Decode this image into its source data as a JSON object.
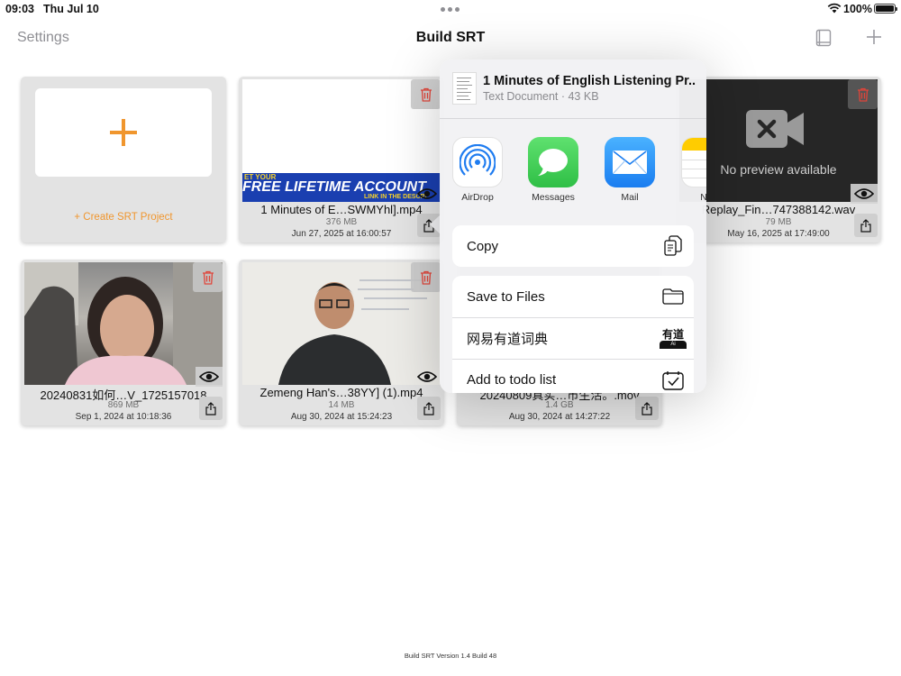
{
  "status_bar": {
    "time": "09:03",
    "date": "Thu Jul 10",
    "battery": "100%"
  },
  "nav": {
    "settings_label": "Settings",
    "title": "Build SRT"
  },
  "create_card": {
    "label": "+ Create SRT Project"
  },
  "projects": [
    {
      "name": "1 Minutes of E…SWMYhl].mp4",
      "size": "376 MB",
      "date": "Jun 27, 2025 at 16:00:57",
      "banner_line1": "ET YOUR",
      "banner_line2": "FREE LIFETIME ACCOUNT",
      "banner_line3": "LINK IN THE DESCRI"
    },
    {
      "name": "Replay_Fin…747388142.wav",
      "size": "79 MB",
      "date": "May 16, 2025 at 17:49:00",
      "preview_text": "No preview available"
    },
    {
      "name": "20240831如何…V_1725157018",
      "size": "869 MB",
      "date": "Sep 1, 2024 at 10:18:36"
    },
    {
      "name": "Zemeng Han's…38YY] (1).mp4",
      "size": "14 MB",
      "date": "Aug 30, 2024 at 15:24:23"
    },
    {
      "name": "20240809真实…市生活。.mov",
      "size": "1.4 GB",
      "date": "Aug 30, 2024 at 14:27:22"
    }
  ],
  "share_sheet": {
    "file_title": "1 Minutes of English Listening Pr...",
    "file_subtitle": "Text Document · 43 KB",
    "apps": [
      {
        "label": "AirDrop",
        "icon": "airdrop-icon"
      },
      {
        "label": "Messages",
        "icon": "messages-icon",
        "color": "#34c759"
      },
      {
        "label": "Mail",
        "icon": "mail-icon",
        "color": "#1a8cff"
      },
      {
        "label": "No",
        "icon": "notes-icon",
        "color": "#ffcc00"
      }
    ],
    "actions": [
      {
        "label": "Copy",
        "icon": "copy-icon"
      },
      {
        "label": "Save to Files",
        "icon": "folder-icon"
      },
      {
        "label": "网易有道词典",
        "icon": "youdao-icon",
        "icon_text": "有道",
        "icon_sub": "Ai"
      },
      {
        "label": "Add to todo list",
        "icon": "calendar-check-icon"
      }
    ]
  },
  "footer": {
    "version": "Build SRT Version 1.4 Build 48"
  },
  "colors": {
    "accent_orange": "#f0962e",
    "delete_red": "#e0453a",
    "card_bg": "#e3e3e3"
  }
}
